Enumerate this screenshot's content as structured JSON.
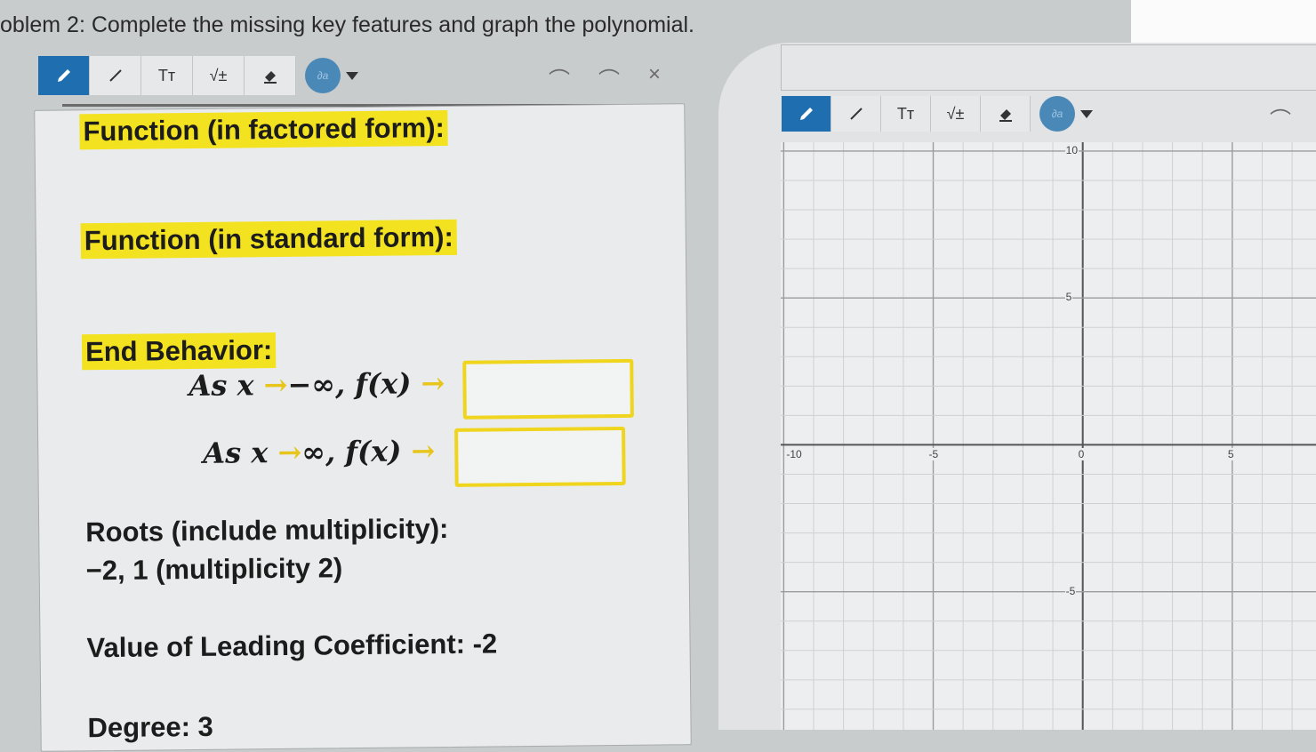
{
  "title": "oblem 2: Complete the missing key features and graph the polynomial.",
  "toolbar": {
    "text_tool": "Tт",
    "math_tool": "√±",
    "color_label": "∂a"
  },
  "history": {
    "undo": "⌒",
    "redo": "⌒",
    "close": "×"
  },
  "worksheet": {
    "factored_label": "Function (in factored form):",
    "standard_label": "Function (in standard form):",
    "end_behavior_label": "End Behavior:",
    "eb_neg_prefix": "As x",
    "eb_neg_arrow": "→",
    "eb_neg_value": "−∞, f(x)",
    "eb_neg_arrow2": "→",
    "eb_pos_prefix": "As x",
    "eb_pos_arrow": "→",
    "eb_pos_value": "∞, f(x)",
    "eb_pos_arrow2": "→",
    "roots_label": "Roots (include multiplicity):",
    "roots_value": "−2, 1 (multiplicity 2)",
    "leading_coef": "Value of Leading Coefficient: -2",
    "degree": "Degree: 3"
  },
  "graph": {
    "x_ticks": [
      {
        "label": "-10",
        "value": -10
      },
      {
        "label": "-5",
        "value": -5
      },
      {
        "label": "0",
        "value": 0
      },
      {
        "label": "5",
        "value": 5
      }
    ],
    "y_ticks": [
      {
        "label": "10",
        "value": 10
      },
      {
        "label": "5",
        "value": 5
      },
      {
        "label": "-5",
        "value": -5
      }
    ],
    "x_visible_range": [
      -10.1,
      7.8
    ],
    "y_visible_range": [
      -9.7,
      10.3
    ],
    "grid_minor_step": 1,
    "grid_major_step": 5
  },
  "colors": {
    "highlight": "#f3e21f",
    "active_tool": "#1f6fb0",
    "pen_color": "#4a88b8",
    "answer_box_border": "#f0d51e"
  }
}
